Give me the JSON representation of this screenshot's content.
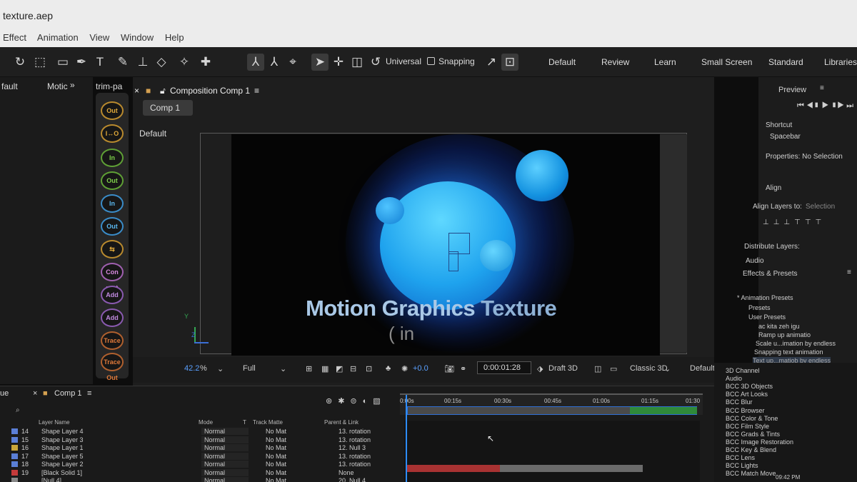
{
  "window": {
    "title": "texture.aep"
  },
  "menu": [
    "Effect",
    "Animation",
    "View",
    "Window",
    "Help"
  ],
  "toolbar": {
    "axis_mode": "Universal",
    "snapping": "Snapping",
    "workspaces": [
      "Default",
      "Review",
      "Learn",
      "Small Screen",
      "Standard",
      "Libraries"
    ]
  },
  "left_tabs": {
    "workspace": "fault",
    "motion": "Motic",
    "trim": "trim-pa"
  },
  "presets": [
    "Out",
    "I↔O",
    "In",
    "Out",
    "In",
    "Out",
    "",
    "Con vert",
    "Add",
    "Add",
    "Trace In",
    "Trace Out",
    "Trace"
  ],
  "composition": {
    "tab_label": "Composition Comp 1",
    "comp_button": "Comp 1",
    "view_label": "Default",
    "title_main": "Motion Graphics",
    "title_second": "Texture",
    "subtitle": "( in",
    "axis_y": "Y",
    "axis_z": "Z"
  },
  "comp_footer": {
    "zoom_value": "42.2",
    "zoom_unit": "%",
    "resolution": "Full",
    "exposure": "+0.0",
    "timecode": "0:00:01:28",
    "draft": "Draft 3D",
    "renderer": "Classic 3D",
    "view": "Default"
  },
  "right_panel": {
    "preview": "Preview",
    "shortcut_label": "Shortcut",
    "shortcut_value": "Spacebar",
    "properties": "Properties: No Selection",
    "align": "Align",
    "align_to_label": "Align Layers to:",
    "align_to_value": "Selection",
    "distribute": "Distribute Layers:",
    "audio": "Audio",
    "effects_title": "Effects & Presets",
    "tree": [
      "* Animation Presets",
      "Presets",
      "User Presets",
      "ac kita zeh igu",
      "Ramp up animatio",
      "Scale u...imation by endless",
      "Snapping text animation",
      "Text up...matiob by endless"
    ]
  },
  "effects_categories": [
    "3D Channel",
    "Audio",
    "BCC 3D Objects",
    "BCC Art Looks",
    "BCC Blur",
    "BCC Browser",
    "BCC Color & Tone",
    "BCC Film Style",
    "BCC Grads & Tints",
    "BCC Image Restoration",
    "BCC Key & Blend",
    "BCC Lens",
    "BCC Lights",
    "BCC Match Move"
  ],
  "timeline": {
    "tab": "Comp 1",
    "left_tab": "ue",
    "columns": {
      "layer_name": "Layer Name",
      "mode": "Mode",
      "t": "T",
      "track_matte": "Track Matte",
      "parent": "Parent & Link"
    },
    "ruler": [
      "0:00s",
      "00:15s",
      "00:30s",
      "00:45s",
      "01:00s",
      "01:15s",
      "01:30"
    ],
    "layers": [
      {
        "num": "14",
        "name": "Shape Layer 4",
        "mode": "Normal",
        "matte": "No Mat",
        "parent": "13. rotation",
        "color": "#5b7fd6"
      },
      {
        "num": "15",
        "name": "Shape Layer 3",
        "mode": "Normal",
        "matte": "No Mat",
        "parent": "13. rotation",
        "color": "#5b7fd6"
      },
      {
        "num": "16",
        "name": "Shape Layer 1",
        "mode": "Normal",
        "matte": "No Mat",
        "parent": "12. Null 3",
        "color": "#c9a63a"
      },
      {
        "num": "17",
        "name": "Shape Layer 5",
        "mode": "Normal",
        "matte": "No Mat",
        "parent": "13. rotation",
        "color": "#5b7fd6"
      },
      {
        "num": "18",
        "name": "Shape Layer 2",
        "mode": "Normal",
        "matte": "No Mat",
        "parent": "13. rotation",
        "color": "#5b7fd6"
      },
      {
        "num": "19",
        "name": "[Black Solid 1]",
        "mode": "Normal",
        "matte": "No Mat",
        "parent": "None",
        "color": "#c43a3a"
      },
      {
        "num": "",
        "name": "[Null 4]",
        "mode": "Normal",
        "matte": "No Mat",
        "parent": "20. Null 4",
        "color": "#888888"
      }
    ]
  },
  "clock": "09:42 PM"
}
